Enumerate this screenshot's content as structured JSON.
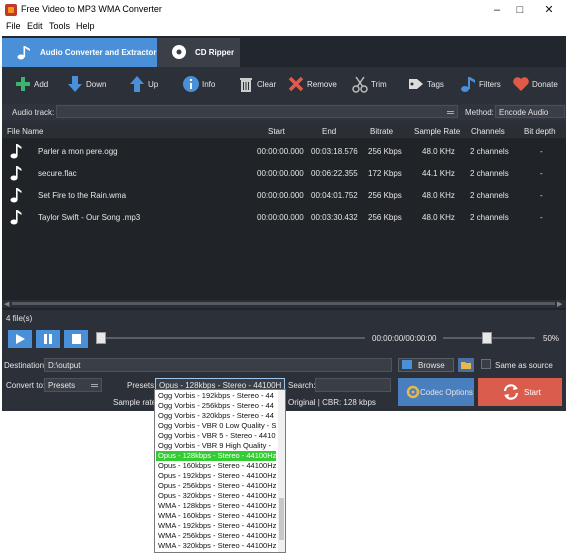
{
  "window": {
    "title": "Free Video to MP3 WMA Converter"
  },
  "menu": [
    "File",
    "Edit",
    "Tools",
    "Help"
  ],
  "tabs": [
    {
      "label": "Audio Converter and Extractor",
      "active": true
    },
    {
      "label": "CD Ripper",
      "active": false
    }
  ],
  "toolbar": {
    "add": "Add",
    "down": "Down",
    "up": "Up",
    "info": "Info",
    "clear": "Clear",
    "remove": "Remove",
    "trim": "Trim",
    "tags": "Tags",
    "filters": "Filters",
    "donate": "Donate"
  },
  "audio_track": {
    "label": "Audio track:",
    "method_label": "Method:",
    "method_value": "Encode Audio"
  },
  "table": {
    "columns": [
      "File Name",
      "Start",
      "End",
      "Bitrate",
      "Sample Rate",
      "Channels",
      "Bit depth"
    ],
    "rows": [
      [
        "Parler a mon pere.ogg",
        "00:00:00.000",
        "00:03:18.576",
        "256 Kbps",
        "48.0 KHz",
        "2 channels",
        "-"
      ],
      [
        "secure.flac",
        "00:00:00.000",
        "00:06:22.355",
        "172 Kbps",
        "44.1 KHz",
        "2 channels",
        "-"
      ],
      [
        "Set Fire to the Rain.wma",
        "00:00:00.000",
        "00:04:01.752",
        "256 Kbps",
        "48.0 KHz",
        "2 channels",
        "-"
      ],
      [
        "Taylor Swift - Our Song .mp3",
        "00:00:00.000",
        "00:03:30.432",
        "256 Kbps",
        "48.0 KHz",
        "2 channels",
        "-"
      ]
    ]
  },
  "status": {
    "file_count": "4 file(s)"
  },
  "player": {
    "time": "00:00:00/00:00:00",
    "volume": "50%",
    "volume_fraction": 0.5,
    "seek_fraction": 0
  },
  "output": {
    "destination_label": "Destination:",
    "destination_value": "D:\\output",
    "browse_label": "Browse",
    "same_as_source_label": "Same as source",
    "same_as_source_checked": false,
    "convert_to_label": "Convert to:",
    "convert_to_value": "Presets",
    "presets_label": "Presets:",
    "presets_value": "Opus - 128kbps - Stereo - 44100H",
    "search_label": "Search:",
    "search_value": "",
    "sample_rate_label": "Sample rate:",
    "sample_rate_info": "Original | CBR: 128 kbps",
    "codec_options_label": "Codec Options",
    "start_label": "Start"
  },
  "presets_dropdown": {
    "options": [
      "Ogg Vorbis - 192kbps - Stereo - 44",
      "Ogg Vorbis - 256kbps - Stereo - 44",
      "Ogg Vorbis - 320kbps - Stereo - 44",
      "Ogg Vorbis - VBR 0 Low Quality - S",
      "Ogg Vorbis - VBR 5 - Stereo - 4410",
      "Ogg Vorbis - VBR 9 High Quality -",
      "Opus - 128kbps - Stereo - 44100Hz",
      "Opus - 160kbps - Stereo - 44100Hz",
      "Opus - 192kbps - Stereo - 44100Hz",
      "Opus - 256kbps - Stereo - 44100Hz",
      "Opus - 320kbps - Stereo - 44100Hz",
      "WMA - 128kbps - Stereo - 44100Hz",
      "WMA - 160kbps - Stereo - 44100Hz",
      "WMA - 192kbps - Stereo - 44100Hz",
      "WMA - 256kbps - Stereo - 44100Hz",
      "WMA - 320kbps - Stereo - 44100Hz"
    ],
    "selected_index": 6
  },
  "colors": {
    "accent": "#4a90d9",
    "start": "#d95c4c",
    "selected_option": "#33cc33",
    "background": "#2c3038"
  }
}
